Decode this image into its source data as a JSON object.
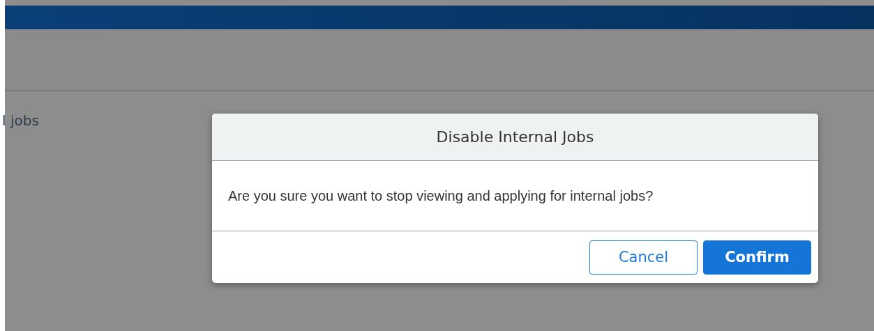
{
  "background": {
    "section_text": "l jobs"
  },
  "dialog": {
    "title": "Disable Internal Jobs",
    "message": "Are you sure you want to stop viewing and applying for internal jobs?",
    "buttons": [
      {
        "label": "Cancel",
        "kind": "secondary"
      },
      {
        "label": "Confirm",
        "kind": "primary"
      }
    ]
  }
}
